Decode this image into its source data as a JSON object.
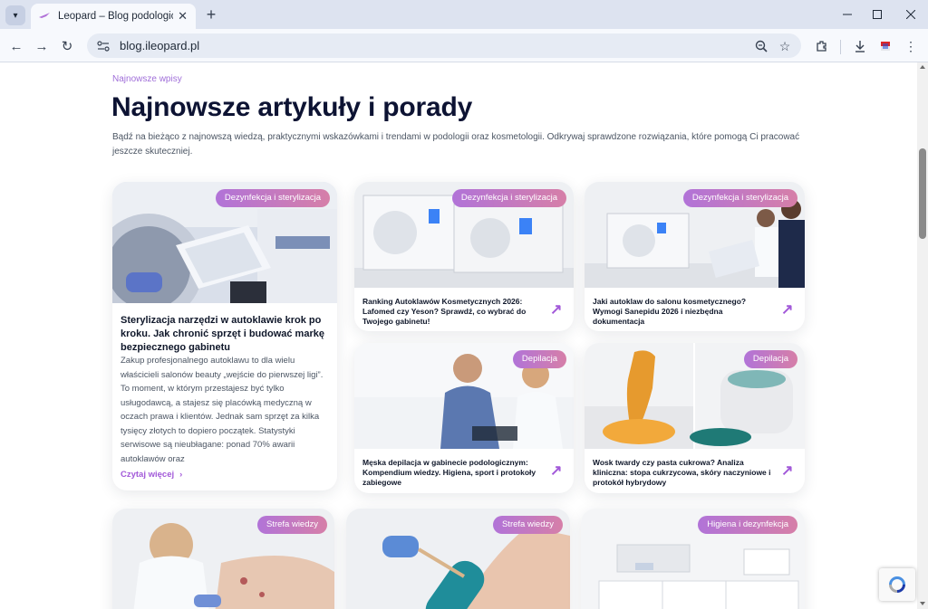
{
  "browser": {
    "tab_title": "Leopard – Blog podologiczny i k",
    "url": "blog.ileopard.pl"
  },
  "page": {
    "eyebrow": "Najnowsze wpisy",
    "heading": "Najnowsze artykuły i porady",
    "lead": "Bądź na bieżąco z najnowszą wiedzą, praktycznymi wskazówkami i trendami w podologii oraz kosmetologii. Odkrywaj sprawdzone rozwiązania, które pomogą Ci pracować jeszcze skuteczniej."
  },
  "featured": {
    "badge": "Dezynfekcja i sterylizacja",
    "title": "Sterylizacja narzędzi w autoklawie krok po kroku. Jak chronić sprzęt i budować markę bezpiecznego gabinetu",
    "excerpt": "Zakup profesjonalnego autoklawu to dla wielu właścicieli salonów beauty „wejście do pierwszej ligi”. To moment, w którym przestajesz być tylko usługodawcą, a stajesz się placówką medyczną w oczach prawa i klientów. Jednak sam sprzęt za kilka tysięcy złotych to dopiero początek. Statystyki serwisowe są nieubłagane: ponad 70% awarii autoklawów oraz",
    "read_more": "Czytaj więcej"
  },
  "cards": [
    {
      "badge": "Dezynfekcja i sterylizacja",
      "title": "Ranking Autoklawów Kosmetycznych 2026: Lafomed czy Yeson? Sprawdź, co wybrać do Twojego gabinetu!"
    },
    {
      "badge": "Dezynfekcja i sterylizacja",
      "title": "Jaki autoklaw do salonu kosmetycznego? Wymogi Sanepidu 2026 i niezbędna dokumentacja"
    },
    {
      "badge": "Depilacja",
      "title": "Męska depilacja w gabinecie podologicznym: Kompendium wiedzy. Higiena, sport i protokoły zabiegowe"
    },
    {
      "badge": "Depilacja",
      "title": "Wosk twardy czy pasta cukrowa? Analiza kliniczna: stopa cukrzycowa, skóry naczyniowe i protokół hybrydowy"
    }
  ],
  "bottom_cards": [
    {
      "badge": "Strefa wiedzy"
    },
    {
      "badge": "Strefa wiedzy"
    },
    {
      "badge": "Higiena i dezynfekcja"
    }
  ],
  "icons": {
    "arrow": "↗",
    "chevron": "›"
  },
  "colors": {
    "accent": "#a259d9",
    "badge_start": "#b173d8",
    "badge_end": "#d67fa8",
    "heading": "#0d1333"
  }
}
